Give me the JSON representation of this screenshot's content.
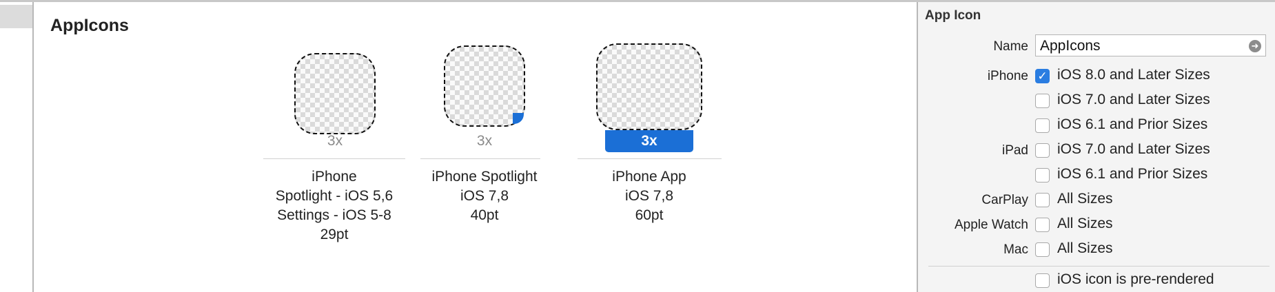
{
  "editor": {
    "set_title": "AppIcons",
    "slots": [
      {
        "scale": "3x",
        "active": false,
        "label_lines": [
          "iPhone",
          "Spotlight - iOS 5,6",
          "Settings - iOS 5-8",
          "29pt"
        ]
      },
      {
        "scale": "3x",
        "active": false,
        "label_lines": [
          "iPhone Spotlight",
          "iOS 7,8",
          "40pt"
        ]
      },
      {
        "scale": "3x",
        "active": true,
        "label_lines": [
          "iPhone App",
          "iOS 7,8",
          "60pt"
        ]
      }
    ]
  },
  "inspector": {
    "title": "App Icon",
    "name_label": "Name",
    "name_value": "AppIcons",
    "groups": [
      {
        "label": "iPhone",
        "options": [
          {
            "text": "iOS 8.0 and Later Sizes",
            "checked": true
          },
          {
            "text": "iOS 7.0 and Later Sizes",
            "checked": false
          },
          {
            "text": "iOS 6.1 and Prior Sizes",
            "checked": false
          }
        ]
      },
      {
        "label": "iPad",
        "options": [
          {
            "text": "iOS 7.0 and Later Sizes",
            "checked": false
          },
          {
            "text": "iOS 6.1 and Prior Sizes",
            "checked": false
          }
        ]
      },
      {
        "label": "CarPlay",
        "options": [
          {
            "text": "All Sizes",
            "checked": false
          }
        ]
      },
      {
        "label": "Apple Watch",
        "options": [
          {
            "text": "All Sizes",
            "checked": false
          }
        ]
      },
      {
        "label": "Mac",
        "options": [
          {
            "text": "All Sizes",
            "checked": false
          }
        ]
      }
    ],
    "prerendered": {
      "text": "iOS icon is pre-rendered",
      "checked": false
    }
  },
  "colors": {
    "accent": "#1b6fd6",
    "checkbox_on": "#2a7de1"
  },
  "icons": {
    "checkmark": "check-icon",
    "go": "arrow-right-circle-icon"
  }
}
